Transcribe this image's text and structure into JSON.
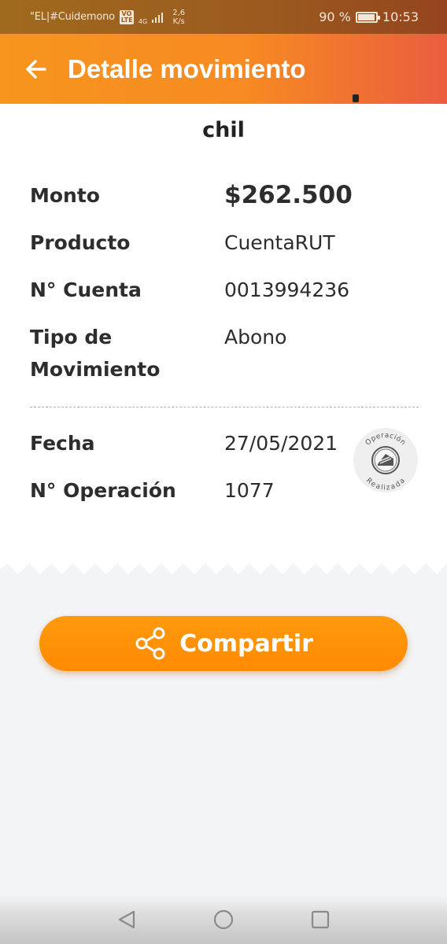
{
  "status_bar": {
    "carrier": "\"EL|#Cuidemono",
    "volte": "VO LTE",
    "net_type": "4G",
    "net_speed_value": "2,6",
    "net_speed_unit": "K/s",
    "battery": "90 %",
    "time": "10:53"
  },
  "header": {
    "title": "Detalle movimiento",
    "back_icon": "arrow-left-icon"
  },
  "receipt": {
    "name_fragment": "chil",
    "fields": [
      {
        "label": "Monto",
        "value": "$262.500"
      },
      {
        "label": "Producto",
        "value": "CuentaRUT"
      },
      {
        "label": "N° Cuenta",
        "value": "0013994236"
      },
      {
        "label": "Tipo de Movimiento",
        "label_line1": "Tipo de",
        "label_line2": "Movimiento",
        "value": "Abono"
      }
    ],
    "date_fields": [
      {
        "label": "Fecha",
        "value": "27/05/2021"
      },
      {
        "label": "N° Operación",
        "value": "1077"
      }
    ],
    "stamp": {
      "top_text": "Operación",
      "bottom_text": "Realizada",
      "icon": "bank-stamp-icon"
    }
  },
  "share": {
    "label": "Compartir",
    "icon": "share-icon"
  },
  "nav": {
    "back_icon": "triangle-back-icon",
    "home_icon": "circle-home-icon",
    "recents_icon": "square-recents-icon"
  },
  "colors": {
    "accent_orange": "#ff8a00",
    "header_start": "#f7951e",
    "header_end": "#ea5d3f",
    "background": "#f3f4f6"
  }
}
